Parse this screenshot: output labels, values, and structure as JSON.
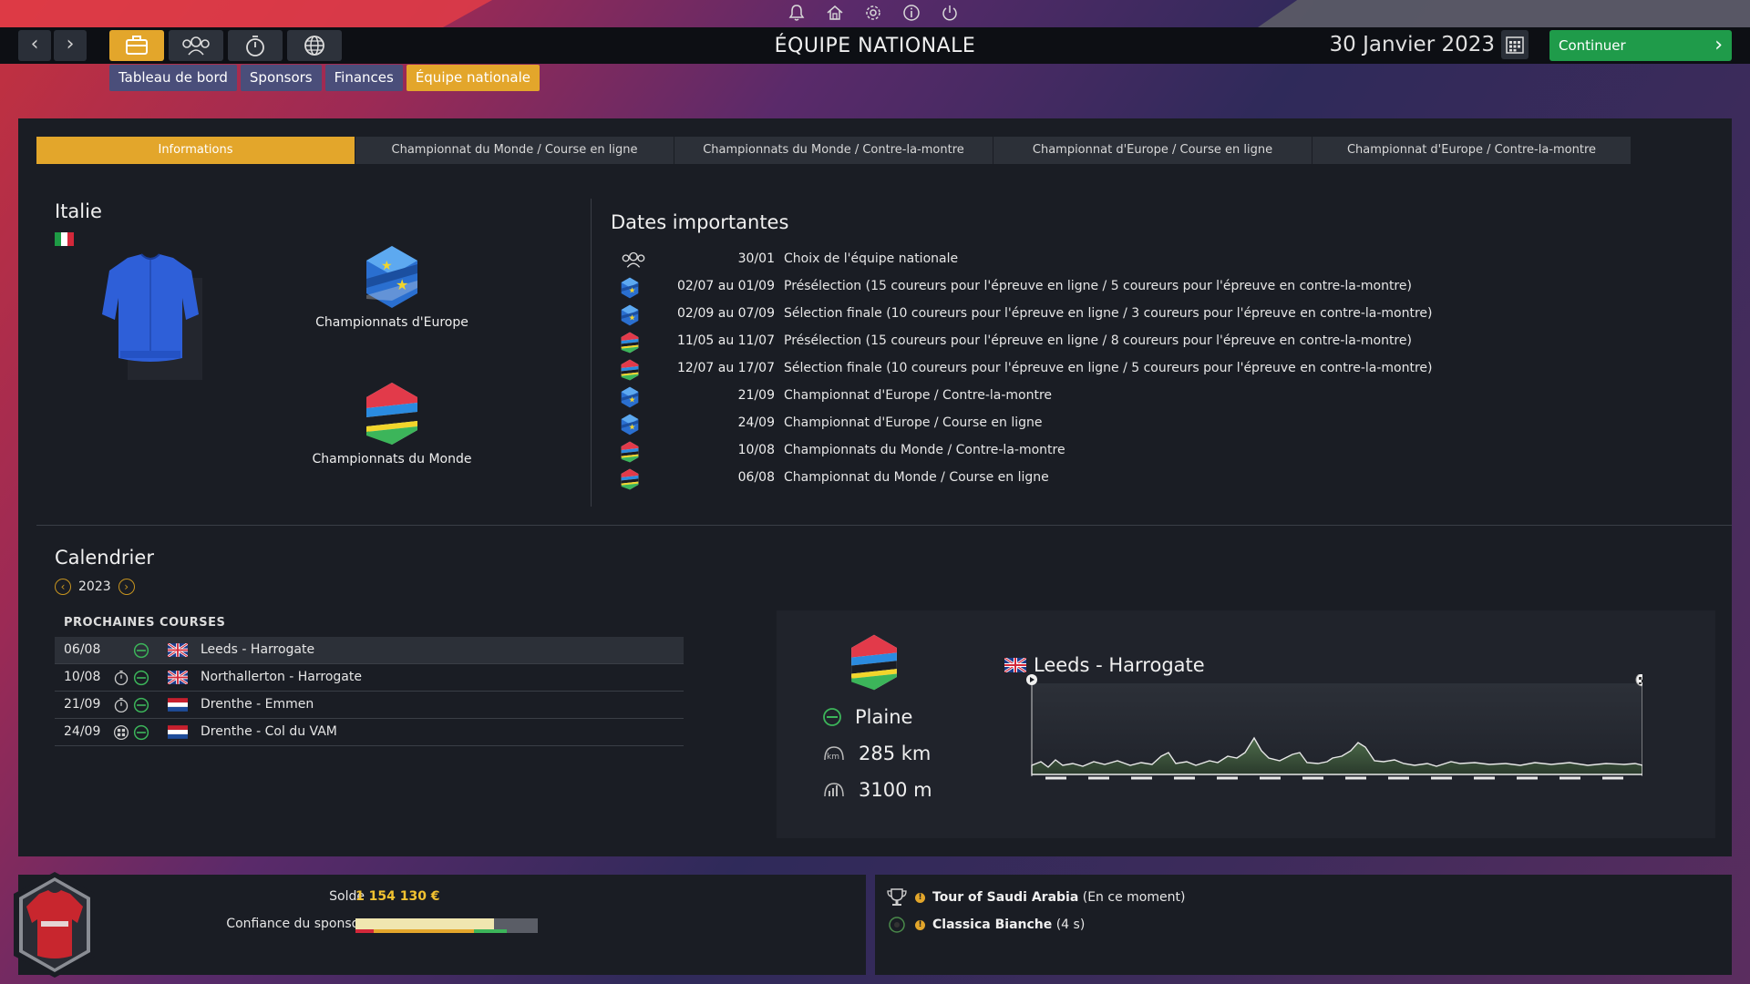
{
  "header": {
    "page_title": "ÉQUIPE NATIONALE",
    "date": "30 Janvier 2023",
    "continue_label": "Continuer",
    "subtabs": [
      "Tableau de bord",
      "Sponsors",
      "Finances",
      "Équipe nationale"
    ],
    "active_subtab": 3
  },
  "tabs": [
    "Informations",
    "Championnat du Monde / Course en ligne",
    "Championnats du Monde / Contre-la-montre",
    "Championnat d'Europe / Course en ligne",
    "Championnat d'Europe / Contre-la-montre"
  ],
  "info": {
    "country": "Italie",
    "champ_europe": "Championnats d'Europe",
    "champ_monde": "Championnats du Monde"
  },
  "dates": {
    "title": "Dates importantes",
    "rows": [
      {
        "icon": "team-icon",
        "date": "30/01",
        "desc": "Choix de l'équipe nationale"
      },
      {
        "icon": "europe-icon",
        "date": "02/07 au 01/09",
        "desc": "Présélection (15 coureurs pour l'épreuve en ligne / 5 coureurs pour l'épreuve en contre-la-montre)"
      },
      {
        "icon": "europe-icon",
        "date": "02/09 au 07/09",
        "desc": "Sélection finale (10 coureurs pour l'épreuve en ligne / 3 coureurs pour l'épreuve en contre-la-montre)"
      },
      {
        "icon": "world-icon",
        "date": "11/05 au 11/07",
        "desc": "Présélection (15 coureurs pour l'épreuve en ligne / 8 coureurs pour l'épreuve en contre-la-montre)"
      },
      {
        "icon": "world-icon",
        "date": "12/07 au 17/07",
        "desc": "Sélection finale (10 coureurs pour l'épreuve en ligne / 5 coureurs pour l'épreuve en contre-la-montre)"
      },
      {
        "icon": "europe-icon",
        "date": "21/09",
        "desc": "Championnat d'Europe / Contre-la-montre"
      },
      {
        "icon": "europe-icon",
        "date": "24/09",
        "desc": "Championnat d'Europe / Course en ligne"
      },
      {
        "icon": "world-icon",
        "date": "10/08",
        "desc": "Championnats du Monde / Contre-la-montre"
      },
      {
        "icon": "world-icon",
        "date": "06/08",
        "desc": "Championnat du Monde / Course en ligne"
      }
    ]
  },
  "calendar": {
    "title": "Calendrier",
    "year": "2023",
    "upcoming_label": "PROCHAINES COURSES",
    "races": [
      {
        "date": "06/08",
        "icons": [
          "flat-icon"
        ],
        "flag": "uk",
        "name": "Leeds - Harrogate"
      },
      {
        "date": "10/08",
        "icons": [
          "clock-icon",
          "flat-icon"
        ],
        "flag": "uk",
        "name": "Northallerton - Harrogate"
      },
      {
        "date": "21/09",
        "icons": [
          "clock-icon",
          "flat-icon"
        ],
        "flag": "nl",
        "name": "Drenthe - Emmen"
      },
      {
        "date": "24/09",
        "icons": [
          "cobble-icon",
          "flat-icon"
        ],
        "flag": "nl",
        "name": "Drenthe - Col du VAM"
      }
    ]
  },
  "race_detail": {
    "name": "Leeds - Harrogate",
    "terrain": "Plaine",
    "distance": "285 km",
    "elevation": "3100 m"
  },
  "footer": {
    "solde_label": "Solde",
    "solde_value": "1 154 130 €",
    "confidence_label": "Confiance du sponsor",
    "confidence_level": 0.76,
    "notifications": [
      {
        "title": "Tour of Saudi Arabia",
        "extra": "(En ce moment)"
      },
      {
        "title": "Classica Bianche",
        "extra": "(4 s)"
      }
    ]
  },
  "colors": {
    "accent": "#e3a62b",
    "continue": "#1f9b4a",
    "subtab": "#4a4e7a",
    "panel": "#1a1d24"
  }
}
